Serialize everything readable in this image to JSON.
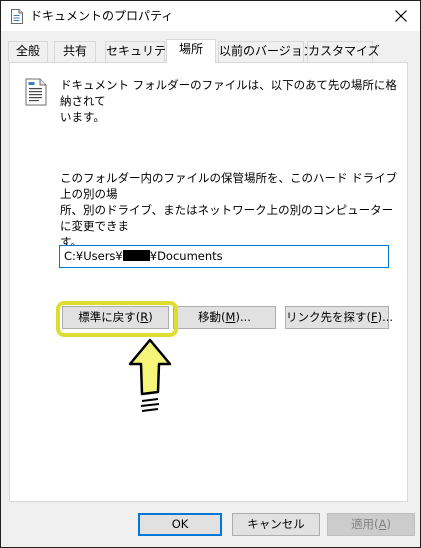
{
  "window": {
    "title": "ドキュメントのプロパティ",
    "icon": "document-icon",
    "close_icon": "close-icon"
  },
  "tabs": [
    {
      "label": "全般",
      "active": false
    },
    {
      "label": "共有",
      "active": false
    },
    {
      "label": "セキュリティ",
      "active": false
    },
    {
      "label": "場所",
      "active": true
    },
    {
      "label": "以前のバージョン",
      "active": false
    },
    {
      "label": "カスタマイズ",
      "active": false
    }
  ],
  "location": {
    "description_line1": "ドキュメント フォルダーのファイルは、以下のあて先の場所に格納されて",
    "description_line2": "います。",
    "info_line1": "このフォルダー内のファイルの保管場所を、このハード ドライブ上の別の場",
    "info_line2": "所、別のドライブ、またはネットワーク上の別のコンピューターに変更できま",
    "info_line3": "す。",
    "path_prefix": "C:¥Users¥",
    "path_suffix": "¥Documents"
  },
  "buttons": {
    "restore_default": {
      "text": "標準に戻す(",
      "accel": "R",
      "end": ")"
    },
    "move": {
      "text": "移動(",
      "accel": "M",
      "end": ")..."
    },
    "find_target": {
      "text": "リンク先を探す(",
      "accel": "F",
      "end": ")..."
    },
    "ok": "OK",
    "cancel": "キャンセル",
    "apply": {
      "text": "適用(",
      "accel": "A",
      "end": ")"
    }
  },
  "annotation": {
    "highlight_color": "#dede30",
    "pointer_color": "#f5f57a"
  },
  "colors": {
    "accent": "#0078d7",
    "dialog_bg": "#f0f0f0",
    "button_bg": "#e1e1e1"
  }
}
